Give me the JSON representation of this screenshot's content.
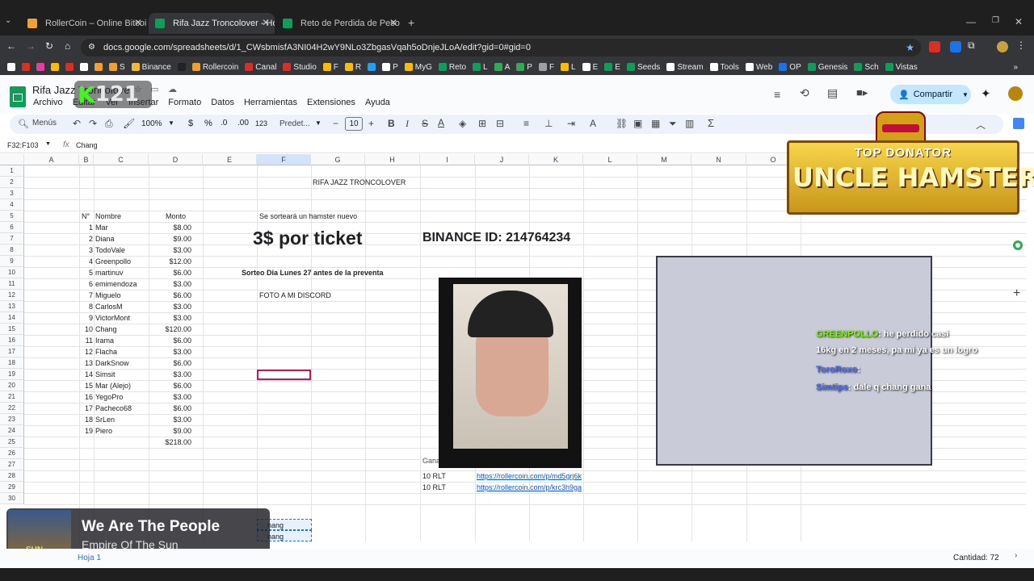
{
  "browser": {
    "tabs": [
      {
        "title": "RollerCoin – Online Bitcoin Mi",
        "color": "#f0a030"
      },
      {
        "title": "Rifa Jazz Troncolover - Hojas d",
        "color": "#0f9d58"
      },
      {
        "title": "Reto de Perdida de Peso - El M",
        "color": "#0f9d58"
      }
    ],
    "url": "docs.google.com/spreadsheets/d/1_CWsbmisfA3NI04H2wY9NLo3ZbgasVqah5oDnjeJLoA/edit?gid=0#gid=0",
    "bookmarks": [
      "",
      "",
      "",
      "",
      "",
      "",
      "",
      "S",
      "Binance",
      "",
      "Rollercoin",
      "Canal",
      "Studio",
      "F",
      "R",
      "",
      "P",
      "MyG",
      "Reto",
      "L",
      "A",
      "P",
      "F",
      "L",
      "E",
      "E",
      "Seeds",
      "Stream",
      "Tools",
      "Web",
      "OP",
      "Genesis",
      "Sch",
      "Vistas"
    ]
  },
  "sheets": {
    "doc_title": "Rifa Jazz Troncolover",
    "menus": [
      "Archivo",
      "Editar",
      "Ver",
      "Insertar",
      "Formato",
      "Datos",
      "Herramientas",
      "Extensiones",
      "Ayuda"
    ],
    "share_label": "Compartir",
    "search_menus": "Menús",
    "zoom": "100%",
    "currency": "$",
    "percent": "%",
    "dec_less": ".0",
    "dec_more": ".00",
    "num_fmt": "123",
    "font_name": "Predet...",
    "font_size": "10",
    "cell_ref": "F32:F103",
    "formula_value": "Chang",
    "columns": [
      "A",
      "B",
      "C",
      "D",
      "E",
      "F",
      "G",
      "H",
      "I",
      "J",
      "K",
      "L",
      "M",
      "N",
      "O"
    ],
    "rows": [
      "1",
      "2",
      "3",
      "4",
      "5",
      "6",
      "7",
      "8",
      "9",
      "10",
      "11",
      "12",
      "13",
      "14",
      "15",
      "16",
      "17",
      "18",
      "19",
      "20",
      "21",
      "22",
      "23",
      "24",
      "25",
      "26",
      "27",
      "28",
      "29",
      "30"
    ],
    "title_cell": "RIFA JAZZ TRONCOLOVER",
    "headers": {
      "num": "N°",
      "name": "Nombre",
      "amount": "Monto"
    },
    "participants": [
      {
        "n": "1",
        "name": "Mar",
        "amount": "$8.00"
      },
      {
        "n": "2",
        "name": "Diana",
        "amount": "$9.00"
      },
      {
        "n": "3",
        "name": "TodoVale",
        "amount": "$3.00"
      },
      {
        "n": "4",
        "name": "Greenpollo",
        "amount": "$12.00"
      },
      {
        "n": "5",
        "name": "martinuv",
        "amount": "$6.00"
      },
      {
        "n": "6",
        "name": "emimendoza",
        "amount": "$3.00"
      },
      {
        "n": "7",
        "name": "Miguelo",
        "amount": "$6.00"
      },
      {
        "n": "8",
        "name": "CarlosM",
        "amount": "$3.00"
      },
      {
        "n": "9",
        "name": "VictorMont",
        "amount": "$3.00"
      },
      {
        "n": "10",
        "name": "Chang",
        "amount": "$120.00"
      },
      {
        "n": "11",
        "name": "Irama",
        "amount": "$6.00"
      },
      {
        "n": "12",
        "name": "Flacha",
        "amount": "$3.00"
      },
      {
        "n": "13",
        "name": "DarkSnow",
        "amount": "$6.00"
      },
      {
        "n": "14",
        "name": "Simsit",
        "amount": "$3.00"
      },
      {
        "n": "15",
        "name": "Mar (Alejo)",
        "amount": "$6.00"
      },
      {
        "n": "16",
        "name": "YegoPro",
        "amount": "$3.00"
      },
      {
        "n": "17",
        "name": "Pacheco68",
        "amount": "$6.00"
      },
      {
        "n": "18",
        "name": "SrLen",
        "amount": "$3.00"
      },
      {
        "n": "19",
        "name": "Piero",
        "amount": "$9.00"
      }
    ],
    "total": "$218.00",
    "hamster_note": "Se sorteará un hamster nuevo",
    "ticket_price": "3$ por ticket",
    "binance": "BINANCE ID: 214764234",
    "draw_date": "Sorteo Dia Lunes 27 antes de la preventa",
    "photo_note": "FOTO A MI DISCORD",
    "ganadores": "Ganadores Premio Preparado...",
    "prizes": [
      {
        "amount": "10 RLT",
        "link": "https://rollercoin.com/p/md5grj6k"
      },
      {
        "amount": "10 RLT",
        "link": "https://rollercoin.com/p/krc3h9ga"
      }
    ],
    "selected_fragments": [
      "nang",
      "nang"
    ],
    "count": "Cantidad: 72",
    "sheet_tab": "Hoja 1"
  },
  "overlays": {
    "donator_top": "TOP DONATOR",
    "donator_name": "UNCLE HAMSTER",
    "logo_text": "121",
    "chat": [
      {
        "user": "GREENPOLLO",
        "msg": ": he perdido casi",
        "user_color": "#7cfc00"
      },
      {
        "user": "",
        "msg": "16kg en 2 meses, pa mi ya es un logro",
        "user_color": "#ffffff"
      },
      {
        "user": "ToroRoxo",
        "msg": ":",
        "user_color": "#4a6cf7"
      },
      {
        "user": "Simtips",
        "msg": ": dale q chang gana",
        "user_color": "#4a6cf7"
      }
    ],
    "song_title": "We Are The People",
    "song_artist": "Empire Of The Sun",
    "album_word": "SUN"
  }
}
